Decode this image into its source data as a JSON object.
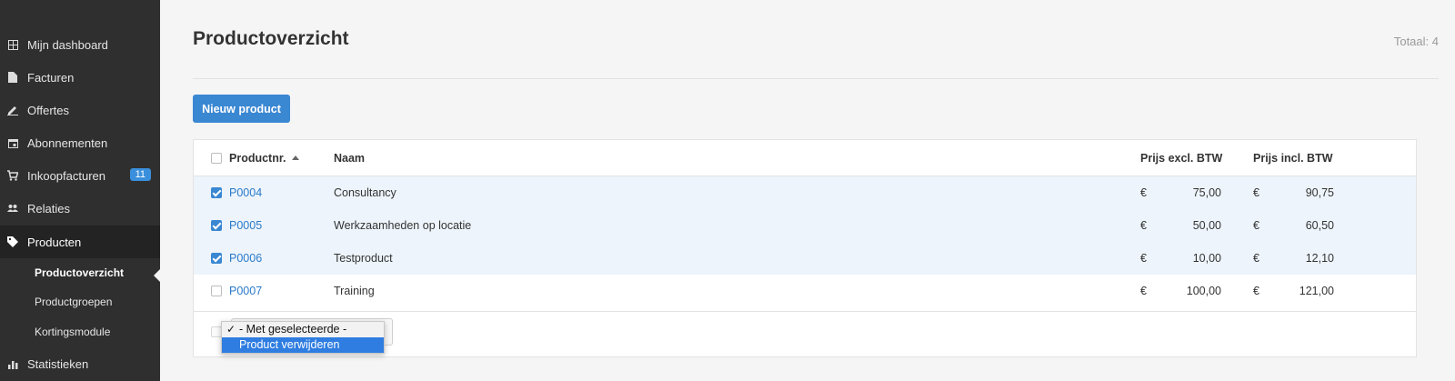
{
  "sidebar": {
    "items": [
      {
        "label": "Mijn dashboard",
        "icon": "grid-icon"
      },
      {
        "label": "Facturen",
        "icon": "document-icon"
      },
      {
        "label": "Offertes",
        "icon": "pen-icon"
      },
      {
        "label": "Abonnementen",
        "icon": "calendar-icon"
      },
      {
        "label": "Inkoopfacturen",
        "icon": "cart-icon",
        "badge": "11"
      },
      {
        "label": "Relaties",
        "icon": "people-icon"
      },
      {
        "label": "Producten",
        "icon": "tag-icon"
      }
    ],
    "subitems": [
      "Productoverzicht",
      "Productgroepen",
      "Kortingsmodule"
    ],
    "bottom_item": {
      "label": "Statistieken",
      "icon": "bar-chart-icon"
    }
  },
  "main": {
    "title": "Productoverzicht",
    "total": "Totaal: 4",
    "new_button": "Nieuw product",
    "columns": {
      "productnr": "Productnr.",
      "naam": "Naam",
      "excl": "Prijs excl. BTW",
      "incl": "Prijs incl. BTW"
    },
    "currency": "€",
    "rows": [
      {
        "nr": "P0004",
        "naam": "Consultancy",
        "excl": "75,00",
        "incl": "90,75",
        "checked": true
      },
      {
        "nr": "P0005",
        "naam": "Werkzaamheden op locatie",
        "excl": "50,00",
        "incl": "60,50",
        "checked": true
      },
      {
        "nr": "P0006",
        "naam": "Testproduct",
        "excl": "10,00",
        "incl": "12,10",
        "checked": true
      },
      {
        "nr": "P0007",
        "naam": "Training",
        "excl": "100,00",
        "incl": "121,00",
        "checked": false
      }
    ],
    "bulk_select": {
      "options": [
        "- Met geselecteerde -",
        "Product verwijderen"
      ],
      "selected": "- Met geselecteerde -",
      "highlighted": "Product verwijderen"
    }
  },
  "colors": {
    "sidebar_bg": "#2f2f2f",
    "accent": "#3a87d2",
    "link": "#2a7ac9",
    "selected_row": "#edf4fb",
    "badge": "#3a8fdc"
  }
}
